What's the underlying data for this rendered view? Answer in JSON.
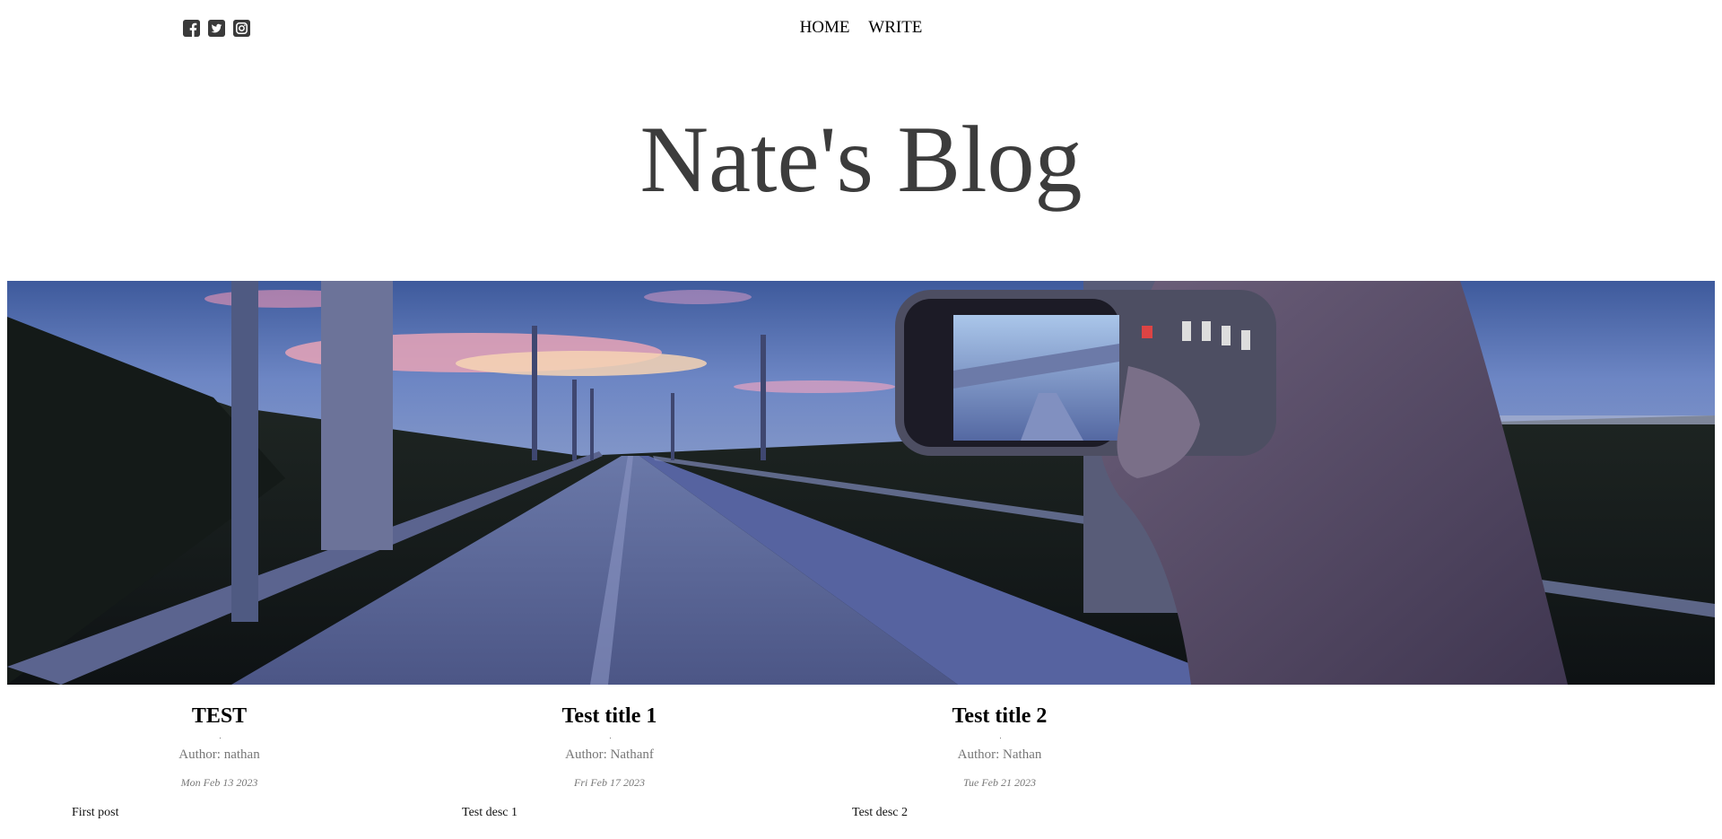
{
  "header": {
    "social_icons": [
      "facebook-icon",
      "twitter-icon",
      "instagram-icon"
    ],
    "nav": {
      "home_label": "HOME",
      "write_label": "WRITE"
    }
  },
  "hero": {
    "title": "Nate's Blog",
    "title_color": "#3c3c3c"
  },
  "banner": {
    "description": "photo of person holding phone over path"
  },
  "posts": [
    {
      "title": "TEST",
      "author": "Author: nathan",
      "date": "Mon Feb 13 2023",
      "desc": "First post"
    },
    {
      "title": "Test title 1",
      "author": "Author: Nathanf",
      "date": "Fri Feb 17 2023",
      "desc": "Test desc 1"
    },
    {
      "title": "Test title 2",
      "author": "Author: Nathan",
      "date": "Tue Feb 21 2023",
      "desc": "Test desc 2"
    }
  ]
}
